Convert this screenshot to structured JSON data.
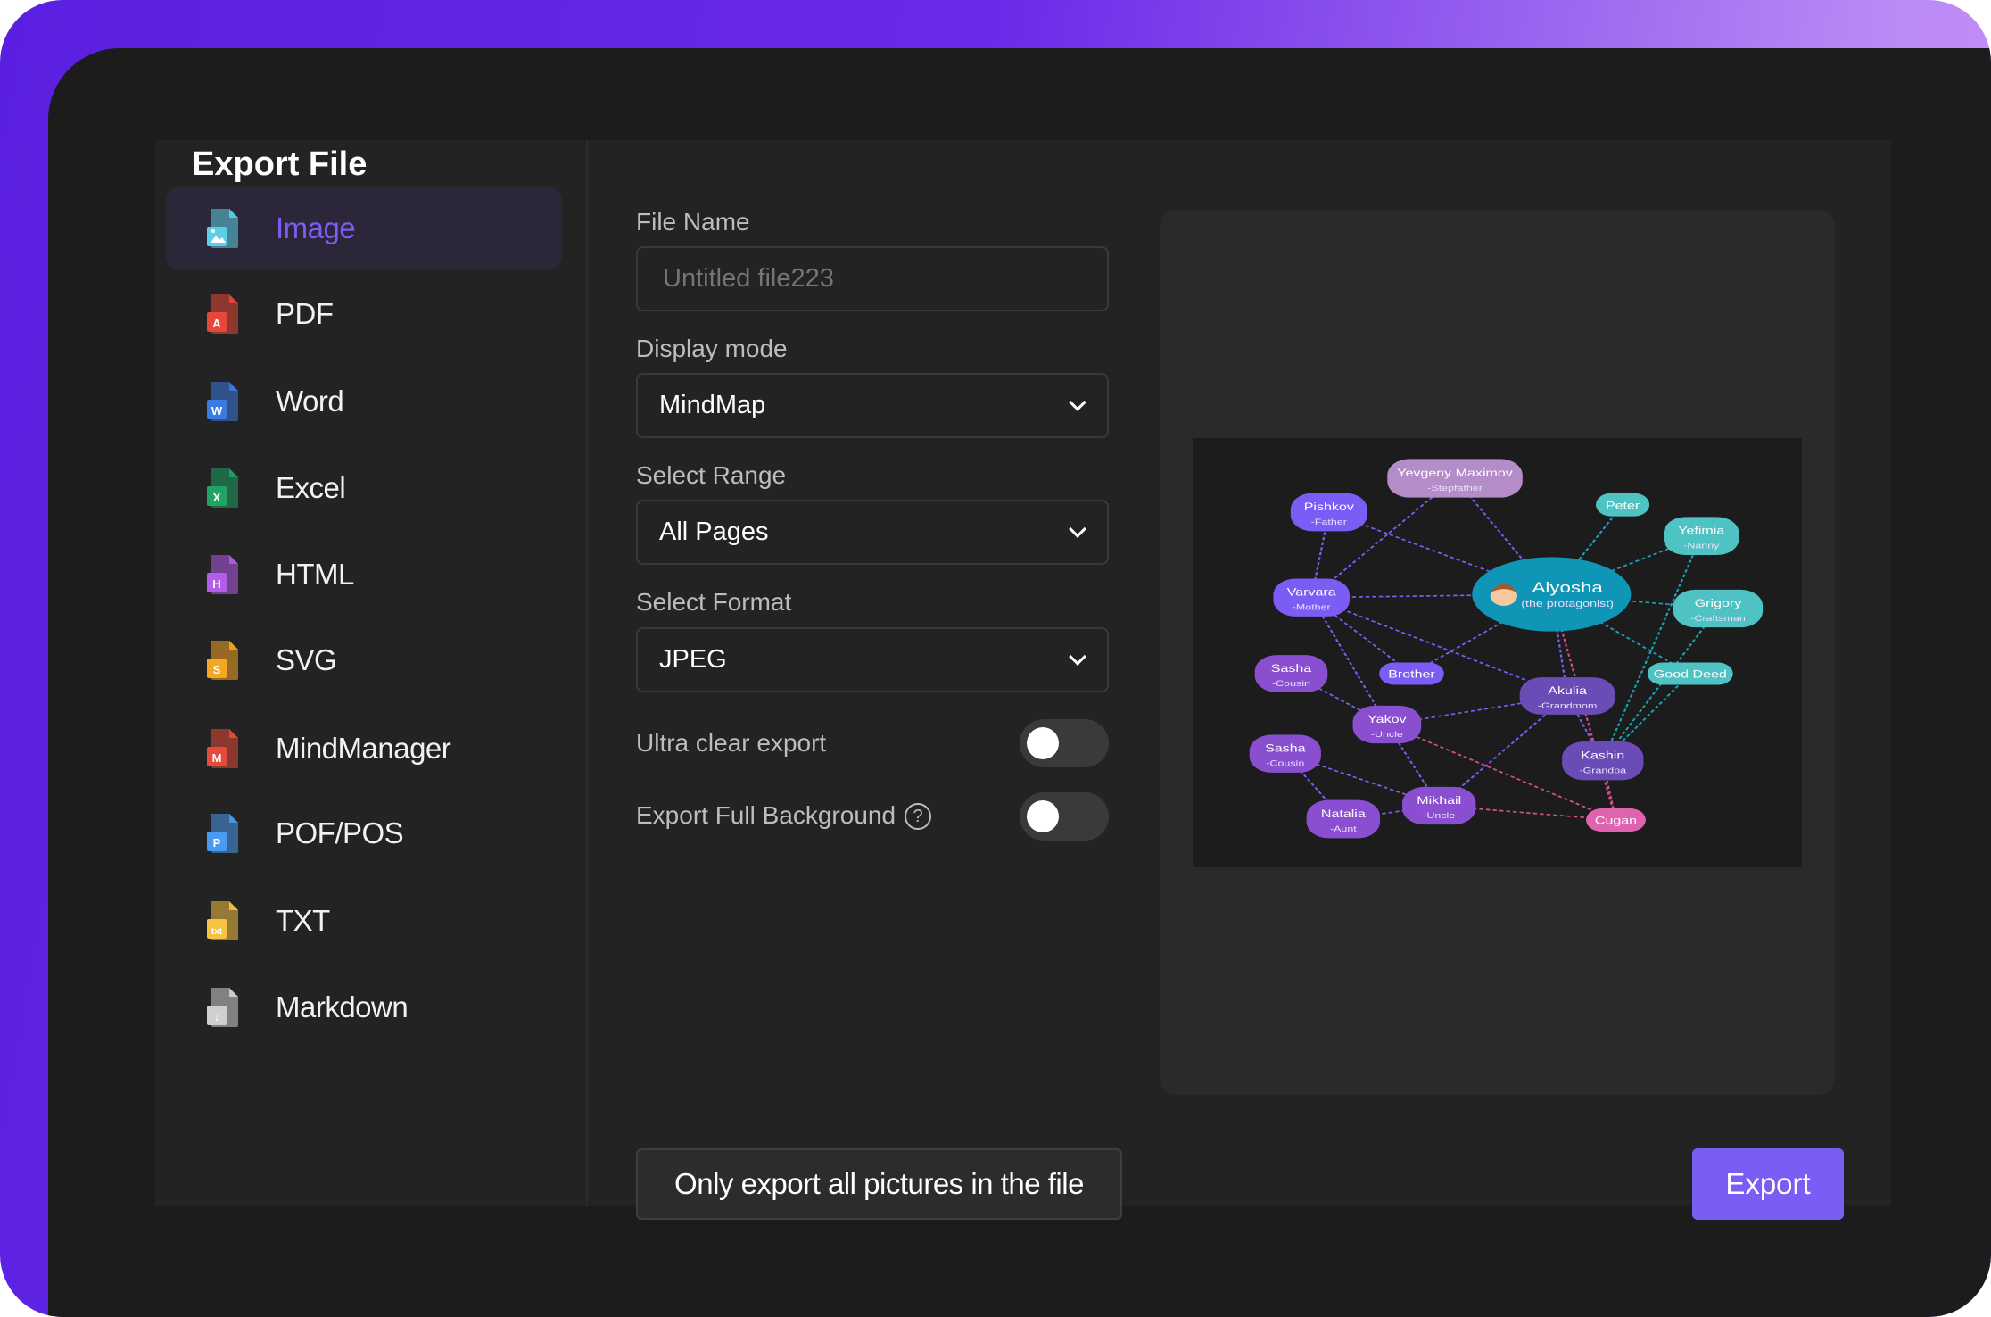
{
  "dialog": {
    "title": "Export File"
  },
  "sidebar": {
    "items": [
      {
        "label": "Image",
        "icon": "image-file-icon",
        "color": "#5ccfe6",
        "active": true,
        "badge": ""
      },
      {
        "label": "PDF",
        "icon": "pdf-file-icon",
        "color": "#e5483a",
        "badge": "A"
      },
      {
        "label": "Word",
        "icon": "word-file-icon",
        "color": "#3b7ae0",
        "badge": "W"
      },
      {
        "label": "Excel",
        "icon": "excel-file-icon",
        "color": "#21a366",
        "badge": "X"
      },
      {
        "label": "HTML",
        "icon": "html-file-icon",
        "color": "#b35de8",
        "badge": "H"
      },
      {
        "label": "SVG",
        "icon": "svg-file-icon",
        "color": "#f5a623",
        "badge": "S"
      },
      {
        "label": "MindManager",
        "icon": "mindmanager-file-icon",
        "color": "#e54a3a",
        "badge": "M"
      },
      {
        "label": "POF/POS",
        "icon": "pof-file-icon",
        "color": "#4a9af0",
        "badge": "P"
      },
      {
        "label": "TXT",
        "icon": "txt-file-icon",
        "color": "#f5c242",
        "badge": "txt"
      },
      {
        "label": "Markdown",
        "icon": "markdown-file-icon",
        "color": "#d0d0d0",
        "badge": "↓"
      }
    ]
  },
  "form": {
    "file_name": {
      "label": "File Name",
      "placeholder": "Untitled file223"
    },
    "display_mode": {
      "label": "Display mode",
      "value": "MindMap"
    },
    "select_range": {
      "label": "Select Range",
      "value": "All Pages"
    },
    "select_format": {
      "label": "Select Format",
      "value": "JPEG"
    },
    "ultra_clear": {
      "label": "Ultra clear export",
      "on": false
    },
    "full_background": {
      "label": "Export Full Background",
      "help": "?",
      "on": false
    }
  },
  "preview": {
    "nodes": [
      {
        "title": "Yevgeny Maximov",
        "sub": "-Stepfather",
        "color": "#b48cc8"
      },
      {
        "title": "Pishkov",
        "sub": "-Father",
        "color": "#7b5cf5"
      },
      {
        "title": "Peter",
        "sub": "",
        "color": "#4fc3c3"
      },
      {
        "title": "Yefimia",
        "sub": "-Nanny",
        "color": "#4fc3c3"
      },
      {
        "title": "Alyosha",
        "sub": "(the protagonist)",
        "color": "#0f95b5"
      },
      {
        "title": "Varvara",
        "sub": "-Mother",
        "color": "#7b5cf5"
      },
      {
        "title": "Grigory",
        "sub": "-Craftsman",
        "color": "#4fc3c3"
      },
      {
        "title": "Sasha",
        "sub": "-Cousin",
        "color": "#8a4fd0"
      },
      {
        "title": "Brother",
        "sub": "",
        "color": "#7b5cf5"
      },
      {
        "title": "Akulia",
        "sub": "-Grandmom",
        "color": "#6b4bb5"
      },
      {
        "title": "Good Deed",
        "sub": "",
        "color": "#4fc3c3"
      },
      {
        "title": "Yakov",
        "sub": "-Uncle",
        "color": "#8a4fd0"
      },
      {
        "title": "Sasha",
        "sub": "-Cousin",
        "color": "#8a4fd0"
      },
      {
        "title": "Kashin",
        "sub": "-Grandpa",
        "color": "#6b4bb5"
      },
      {
        "title": "Mikhail",
        "sub": "-Uncle",
        "color": "#8a4fd0"
      },
      {
        "title": "Natalia",
        "sub": "-Aunt",
        "color": "#8a4fd0"
      },
      {
        "title": "Cugan",
        "sub": "",
        "color": "#e063b0"
      }
    ],
    "edges": [
      [
        0,
        5
      ],
      [
        0,
        4
      ],
      [
        1,
        4
      ],
      [
        1,
        5
      ],
      [
        5,
        4
      ],
      [
        4,
        2
      ],
      [
        4,
        3
      ],
      [
        4,
        6
      ],
      [
        4,
        10
      ],
      [
        4,
        9
      ],
      [
        4,
        8
      ],
      [
        5,
        8
      ],
      [
        5,
        9
      ],
      [
        5,
        11
      ],
      [
        7,
        11
      ],
      [
        9,
        11
      ],
      [
        9,
        14
      ],
      [
        9,
        13
      ],
      [
        11,
        14
      ],
      [
        11,
        16
      ],
      [
        12,
        14
      ],
      [
        12,
        15
      ],
      [
        14,
        15
      ],
      [
        14,
        16
      ],
      [
        13,
        16
      ],
      [
        4,
        16
      ],
      [
        10,
        13
      ],
      [
        6,
        13
      ],
      [
        3,
        13
      ]
    ]
  },
  "actions": {
    "only_pictures": "Only export all pictures in the file",
    "export": "Export"
  }
}
